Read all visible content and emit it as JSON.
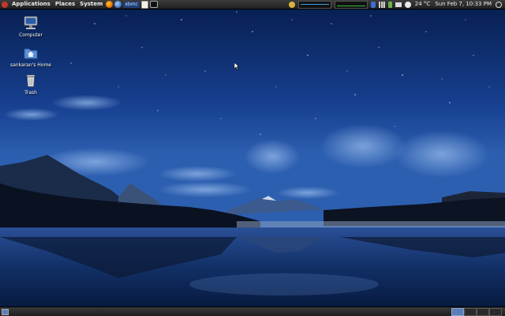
{
  "top_panel": {
    "menus": [
      "Applications",
      "Places",
      "System"
    ],
    "launchers": [
      {
        "icon": "firefox-icon",
        "color": "#e66000"
      },
      {
        "icon": "web-browser-icon",
        "color": "#3a6fc4"
      }
    ],
    "xbmc_label": "xbmc",
    "clock": "Sun Feb 7, 10:33 PM",
    "weather": "24 °C"
  },
  "desktop_icons": [
    {
      "label": "Computer",
      "icon": "computer-icon"
    },
    {
      "label": "sankaran's Home",
      "icon": "home-folder-icon"
    },
    {
      "label": "Trash",
      "icon": "trash-icon"
    }
  ],
  "bottom_panel": {
    "workspaces": 4,
    "active_workspace": 1
  },
  "colors": {
    "sky_top": "#0a2f6e",
    "sky_mid": "#1a4fa0",
    "lake": "#0d2a5a",
    "panel": "#2a2a2a"
  }
}
